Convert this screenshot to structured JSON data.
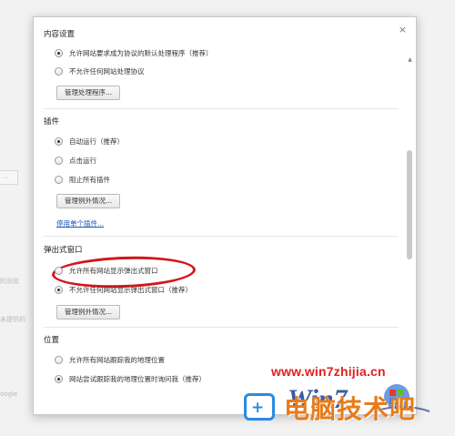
{
  "background": {
    "fragments": [
      "…",
      "的浏览",
      "未提供的",
      "oogle"
    ]
  },
  "dialog": {
    "close_glyph": "×",
    "sections": {
      "content_settings": {
        "title": "内容设置",
        "options": [
          {
            "label": "允许网站要求成为协议的默认处理程序（推荐）",
            "checked": true
          },
          {
            "label": "不允许任何网站处理协议",
            "checked": false
          }
        ],
        "button": "管理处理程序..."
      },
      "plugins": {
        "title": "插件",
        "options": [
          {
            "label": "自动运行（推荐）",
            "checked": true
          },
          {
            "label": "点击运行",
            "checked": false
          },
          {
            "label": "阻止所有插件",
            "checked": false
          }
        ],
        "button": "管理例外情况...",
        "link": "停用单个插件..."
      },
      "popups": {
        "title": "弹出式窗口",
        "options": [
          {
            "label": "允许所有网站显示弹出式窗口",
            "checked": false
          },
          {
            "label": "不允许任何网站显示弹出式窗口（推荐）",
            "checked": true
          }
        ],
        "button": "管理例外情况..."
      },
      "location": {
        "title": "位置",
        "options": [
          {
            "label": "允许所有网站跟踪我的地理位置",
            "checked": false
          },
          {
            "label": "网站尝试跟踪我的地理位置时询问我（推荐）",
            "checked": true
          }
        ]
      }
    }
  },
  "watermark": {
    "url": "www.win7zhijia.cn",
    "site_name": "电脑技术吧",
    "logo_text": "Win7"
  },
  "colors": {
    "annotation": "#d3161c",
    "link": "#1a55b5",
    "watermark_red": "#e01e1e",
    "watermark_orange": "#e87b1a"
  }
}
